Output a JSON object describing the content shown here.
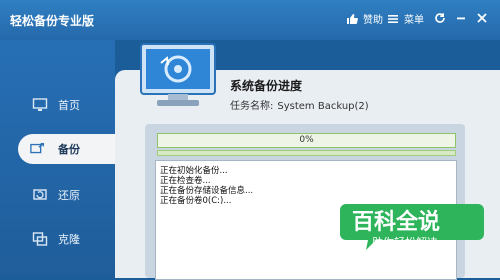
{
  "app": {
    "title": "轻松备份专业版"
  },
  "toolbar": {
    "like_label": "赞助",
    "menu_label": "菜单"
  },
  "sidebar": {
    "items": [
      {
        "label": "首页"
      },
      {
        "label": "备份"
      },
      {
        "label": "还原"
      },
      {
        "label": "克隆"
      }
    ]
  },
  "task": {
    "title": "系统备份进度",
    "name_label": "任务名称:",
    "name_value": "System Backup(2)"
  },
  "progress": {
    "text": "0%",
    "fraction": 0.0
  },
  "log": {
    "lines": [
      "正在初始化备份...",
      "正在检查卷...",
      "正在备份存储设备信息...",
      "正在备份卷0(C:)..."
    ]
  },
  "watermark": {
    "main": "百科全说",
    "sub": "助你轻松解决"
  },
  "colors": {
    "accent": "#2a73b8",
    "progress_green": "#a8dc80",
    "watermark_green": "#2eb45a"
  },
  "icons": {
    "like": "thumb-up-icon",
    "menu": "menu-list-icon",
    "refresh": "refresh-icon",
    "minimize": "minimize-icon",
    "close": "close-icon",
    "home": "home-monitor-icon",
    "backup": "backup-icon",
    "restore": "restore-icon",
    "clone": "clone-icon"
  }
}
